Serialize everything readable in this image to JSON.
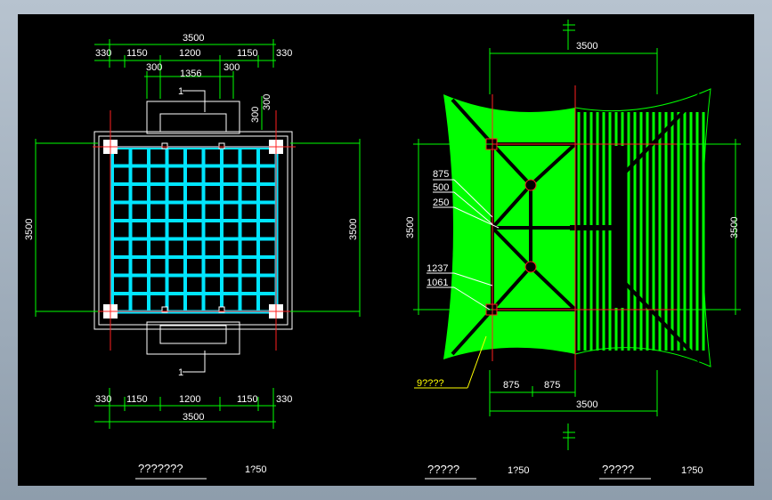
{
  "plan": {
    "top_total": "3500",
    "top_segments": [
      "330",
      "1150",
      "1200",
      "1150",
      "330"
    ],
    "top_sub": [
      "300",
      "1356",
      "300"
    ],
    "section_mark_top": "1",
    "section_mark_bottom": "1",
    "right_small": "300",
    "right_small2": "300",
    "left_height": "3500",
    "right_height": "3500",
    "bottom_segments": [
      "330",
      "1150",
      "1200",
      "1150",
      "330"
    ],
    "bottom_total": "3500",
    "title": "???????",
    "scale": "1?50"
  },
  "roof": {
    "top_total": "3500",
    "left_height": "3500",
    "right_height": "3500",
    "side_labels": [
      "875",
      "500",
      "250",
      "1237",
      "1061"
    ],
    "angle_label": "9????",
    "bottom_segments": [
      "875",
      "875"
    ],
    "bottom_total": "3500",
    "title_left": "?????",
    "scale_left": "1?50",
    "title_right": "?????",
    "scale_right": "1?50"
  },
  "colors": {
    "dimension": "#00ff00",
    "outline": "#ffffff",
    "axis": "#ff2020",
    "grid": "#00e5ff",
    "roof_fill": "#00ff00"
  }
}
